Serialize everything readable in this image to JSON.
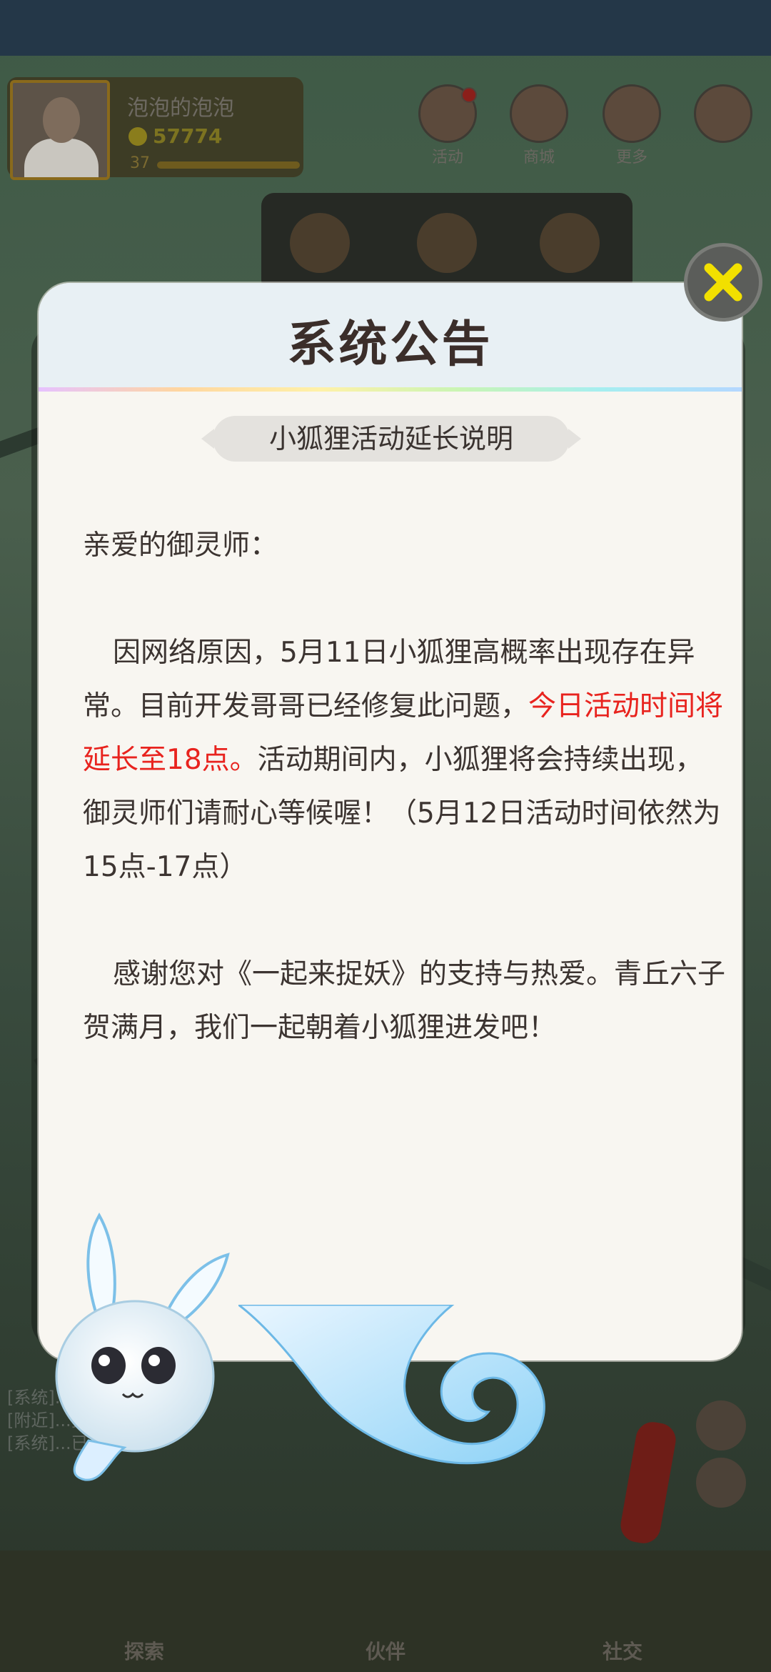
{
  "game": {
    "player": {
      "name": "泡泡的泡泡",
      "coins": "57774",
      "level": "37"
    },
    "top_buttons": [
      {
        "label": "活动"
      },
      {
        "label": "商城"
      },
      {
        "label": "更多"
      }
    ],
    "bottom_tabs": [
      {
        "label": "探索"
      },
      {
        "label": "伙伴"
      },
      {
        "label": "社交"
      }
    ],
    "chat_lines": [
      "[系统]...妖灵",
      "[附近]...捕捉...近期地标",
      "[系统]...已...妖灵"
    ]
  },
  "modal": {
    "title": "系统公告",
    "subtitle": "小狐狸活动延长说明",
    "greeting": "亲爱的御灵师：",
    "paragraph1_part1": "因网络原因，5月11日小狐狸高概率出现存在异常。目前开发哥哥已经修复此问题，",
    "paragraph1_highlight": "今日活动时间将延长至18点。",
    "paragraph1_part2": "活动期间内，小狐狸将会持续出现，御灵师们请耐心等候喔！（5月12日活动时间依然为15点-17点）",
    "paragraph2": "感谢您对《一起来捉妖》的支持与热爱。青丘六子贺满月，我们一起朝着小狐狸进发吧！",
    "highlight_color": "#e8231e",
    "close_icon": "close-x-icon"
  }
}
